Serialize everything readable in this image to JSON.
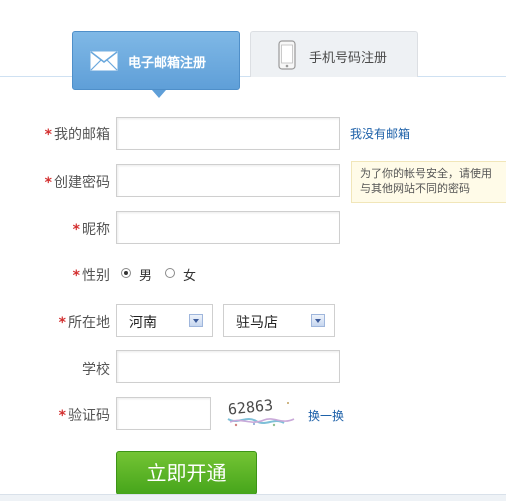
{
  "tabs": {
    "email_label": "电子邮箱注册",
    "phone_label": "手机号码注册"
  },
  "form": {
    "email_label": "我的邮箱",
    "email_value": "",
    "no_email_link": "我没有邮箱",
    "password_label": "创建密码",
    "password_value": "",
    "password_tip": "为了你的帐号安全，请使用与其他网站不同的密码",
    "nickname_label": "昵称",
    "nickname_value": "",
    "gender_label": "性别",
    "gender_male": "男",
    "gender_female": "女",
    "location_label": "所在地",
    "province": "河南",
    "city": "驻马店",
    "school_label": "学校",
    "school_value": "",
    "captcha_label": "验证码",
    "captcha_value": "",
    "captcha_text": "62863",
    "refresh_captcha": "换一换",
    "submit_label": "立即开通"
  },
  "colors": {
    "accent": "#5f9fd8",
    "required": "#d32f2f",
    "submit": "#4caf22",
    "link": "#1b5fa8"
  }
}
